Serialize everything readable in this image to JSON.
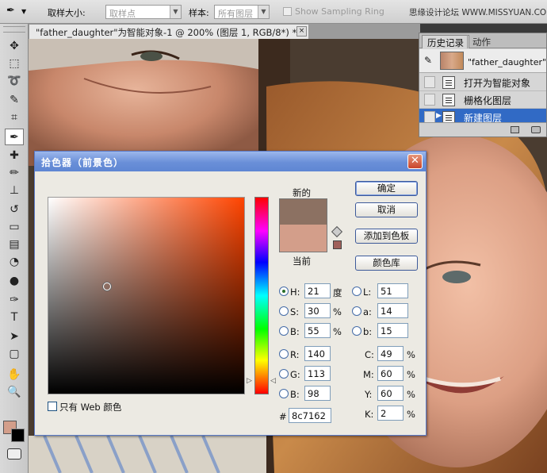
{
  "options_bar": {
    "sample_size_label": "取样大小:",
    "sample_size_value": "取样点",
    "sample_label": "样本:",
    "sample_value": "所有图层",
    "show_ring_label": "Show Sampling Ring",
    "watermark": "思缘设计论坛 WWW.MISSYUAN.COM"
  },
  "document": {
    "tab_title": "\"father_daughter\"为智能对象-1 @ 200% (图层 1, RGB/8*) *",
    "close_glyph": "×"
  },
  "history_panel": {
    "tab_history": "历史记录",
    "tab_actions": "动作",
    "snapshot_name": "\"father_daughter\"为智",
    "steps": [
      {
        "label": "打开为智能对象",
        "selected": false
      },
      {
        "label": "栅格化图层",
        "selected": false
      },
      {
        "label": "新建图层",
        "selected": true
      }
    ]
  },
  "color_picker": {
    "title": "拾色器（前景色）",
    "close_glyph": "✕",
    "new_label": "新的",
    "current_label": "当前",
    "new_color": "#8c7162",
    "current_color": "#d39e8a",
    "hue_base_color": "#ff4400",
    "buttons": {
      "ok": "确定",
      "cancel": "取消",
      "add_to_swatches": "添加到色板",
      "color_libraries": "颜色库"
    },
    "fields": {
      "H": {
        "label": "H:",
        "value": "21",
        "unit": "度"
      },
      "S": {
        "label": "S:",
        "value": "30",
        "unit": "%"
      },
      "Bv": {
        "label": "B:",
        "value": "55",
        "unit": "%"
      },
      "L": {
        "label": "L:",
        "value": "51"
      },
      "a": {
        "label": "a:",
        "value": "14"
      },
      "b": {
        "label": "b:",
        "value": "15"
      },
      "R": {
        "label": "R:",
        "value": "140"
      },
      "G": {
        "label": "G:",
        "value": "113"
      },
      "B": {
        "label": "B:",
        "value": "98"
      },
      "C": {
        "label": "C:",
        "value": "49",
        "unit": "%"
      },
      "M": {
        "label": "M:",
        "value": "60",
        "unit": "%"
      },
      "Y": {
        "label": "Y:",
        "value": "60",
        "unit": "%"
      },
      "K": {
        "label": "K:",
        "value": "2",
        "unit": "%"
      },
      "hex": {
        "label": "#",
        "value": "8c7162"
      }
    },
    "web_only_label": "只有 Web 颜色"
  },
  "toolbox": {
    "foreground_color": "#d39e8a",
    "background_color": "#000000",
    "tools": [
      "move-icon",
      "marquee-icon",
      "lasso-icon",
      "quick-select-icon",
      "crop-icon",
      "eyedropper-icon",
      "healing-icon",
      "brush-icon",
      "stamp-icon",
      "history-brush-icon",
      "eraser-icon",
      "gradient-icon",
      "blur-icon",
      "dodge-icon",
      "pen-icon",
      "type-icon",
      "path-select-icon",
      "shape-icon",
      "hand-icon",
      "zoom-icon"
    ],
    "tool_glyphs": [
      "✥",
      "⬚",
      "➰",
      "✎",
      "⌗",
      "✒",
      "✚",
      "✏",
      "⊥",
      "↺",
      "▭",
      "▤",
      "◔",
      "●",
      "✑",
      "T",
      "➤",
      "▢",
      "✋",
      "🔍"
    ]
  }
}
